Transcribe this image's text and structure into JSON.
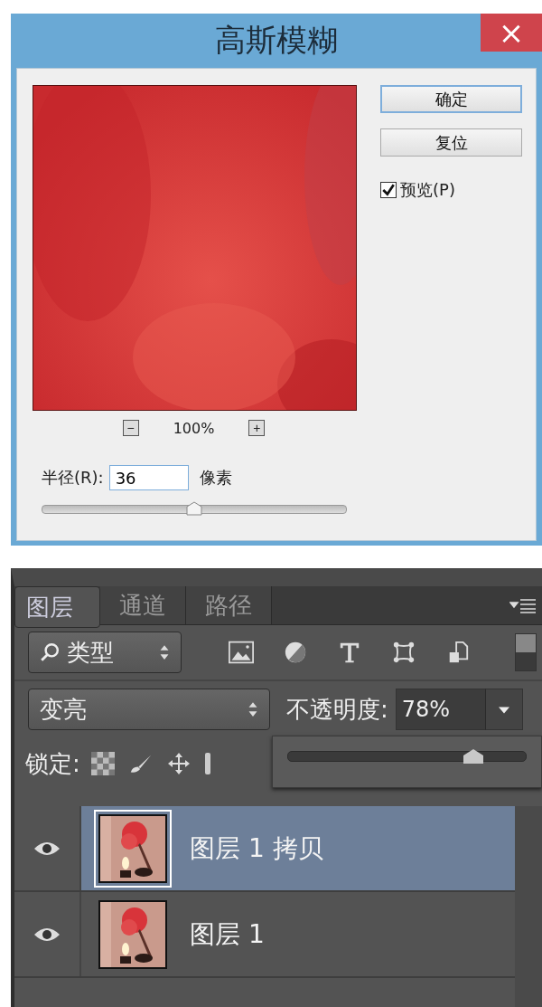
{
  "dialog": {
    "title": "高斯模糊",
    "close": "×",
    "buttons": [
      "确定",
      "复位"
    ],
    "preview": {
      "label": "预览(P)",
      "checked": true
    },
    "zoom": {
      "minus": "−",
      "plus": "+",
      "value": "100%"
    },
    "radius": {
      "label": "半径(R):",
      "value": "36",
      "unit": "像素",
      "level": 0.5
    }
  },
  "layers_panel": {
    "tabs": [
      {
        "label": "图层",
        "selected": true
      },
      {
        "label": "通道",
        "selected": false
      },
      {
        "label": "路径",
        "selected": false
      }
    ],
    "filter": "类型",
    "blend_mode": "变亮",
    "opacity_label": "不透明度:",
    "opacity": "78%",
    "opacity_slider": {
      "level": 0.78
    },
    "lock_label": "锁定:",
    "layers": [
      {
        "name": "图层 1 拷贝",
        "selected": true,
        "visible": true
      },
      {
        "name": "图层 1",
        "selected": false,
        "visible": true
      }
    ]
  }
}
